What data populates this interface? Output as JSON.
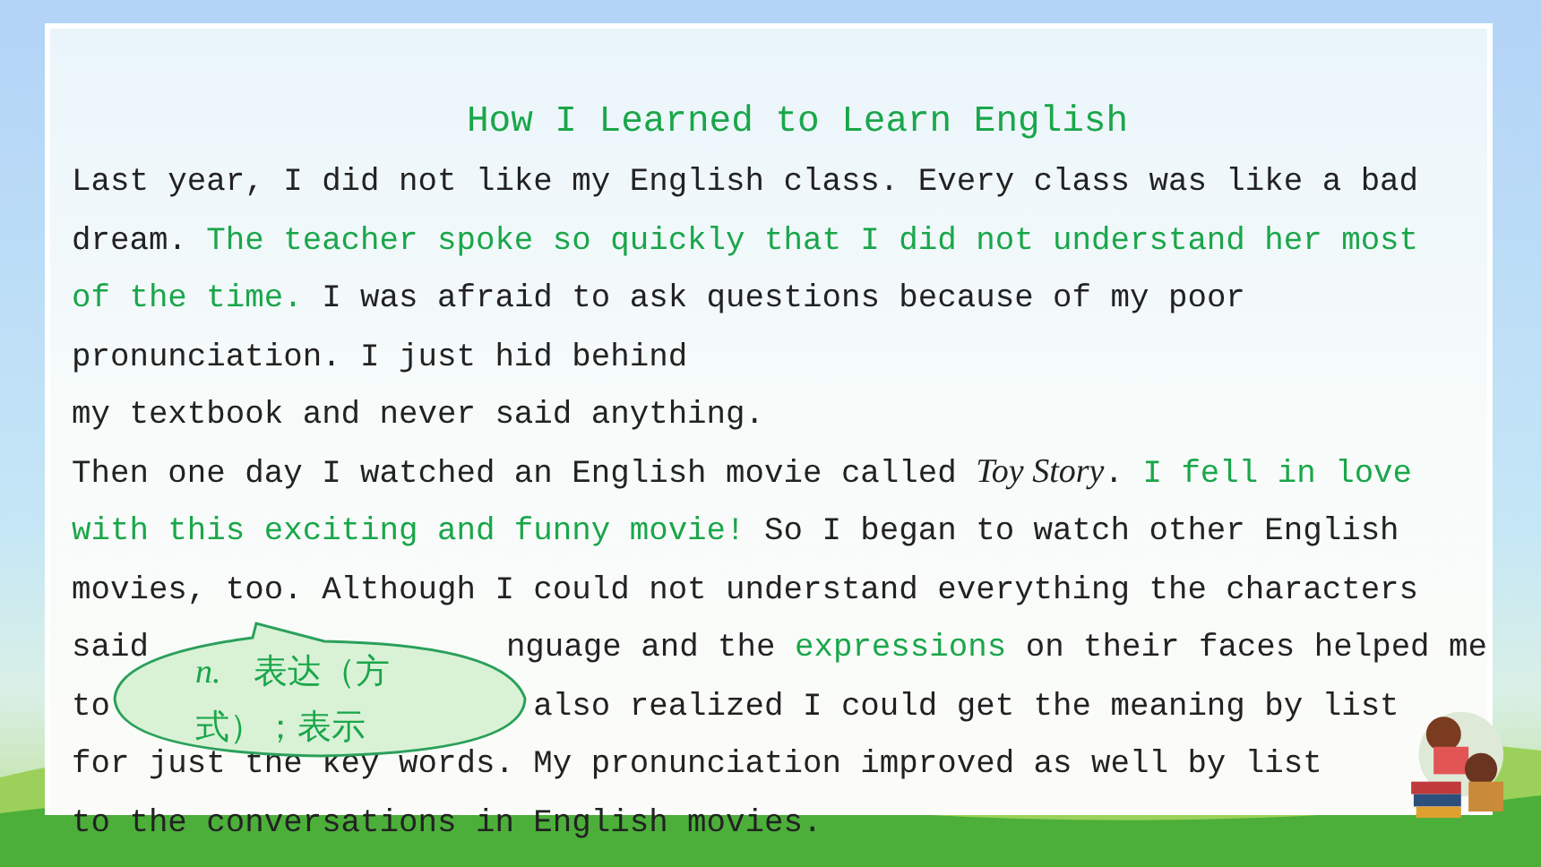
{
  "title": "How I Learned to Learn English",
  "lines": [
    {
      "parts": [
        [
          {
            "text": "Last year, I did not like my English class. Every class was like a bad",
            "kind": "plain"
          }
        ]
      ]
    },
    {
      "parts": [
        [
          {
            "text": "dream. ",
            "kind": "plain"
          },
          {
            "text": "The teacher spoke so quickly that I did not understand her most",
            "kind": "green"
          }
        ]
      ]
    },
    {
      "parts": [
        [
          {
            "text": "of the time.",
            "kind": "green"
          },
          {
            "text": " I was afraid to ask questions because of my poor",
            "kind": "plain"
          }
        ]
      ]
    },
    {
      "parts": [
        [
          {
            "text": "pronunciation. I just hid behind",
            "kind": "plain"
          }
        ]
      ]
    },
    {
      "parts": [
        [
          {
            "text": "my textbook and never said anything.",
            "kind": "plain"
          }
        ]
      ]
    },
    {
      "parts": [
        [
          {
            "text": "Then one day I watched an English movie called ",
            "kind": "plain"
          },
          {
            "text": "Toy Story",
            "kind": "italic"
          },
          {
            "text": ". ",
            "kind": "plain"
          },
          {
            "text": "I fell in love",
            "kind": "green"
          }
        ]
      ]
    },
    {
      "parts": [
        [
          {
            "text": "with this exciting and funny movie!",
            "kind": "green"
          },
          {
            "text": " So I began to watch other English",
            "kind": "plain"
          }
        ]
      ]
    },
    {
      "parts": [
        [
          {
            "text": "movies, too. Although I could not understand everything the characters",
            "kind": "plain"
          }
        ]
      ]
    },
    {
      "parts": [
        [
          {
            "text": "said",
            "kind": "plain"
          }
        ],
        [
          {
            "text": "nguage and the ",
            "kind": "plain"
          },
          {
            "text": "expressions",
            "kind": "green"
          },
          {
            "text": " on their faces helped me",
            "kind": "plain"
          }
        ]
      ]
    },
    {
      "parts": [
        [
          {
            "text": "to",
            "kind": "plain"
          }
        ],
        [
          {
            "text": "also realized I could get the meaning by list",
            "kind": "plain"
          }
        ]
      ]
    },
    {
      "parts": [
        [
          {
            "text": "for just the key words. My pronunciation improved as well by list",
            "kind": "plain"
          }
        ]
      ]
    },
    {
      "parts": [
        [
          {
            "text": "to the conversations in English movies.",
            "kind": "plain"
          }
        ]
      ]
    }
  ],
  "callout": {
    "part_of_speech": "n.",
    "definition": "表达（方式）；表示"
  }
}
